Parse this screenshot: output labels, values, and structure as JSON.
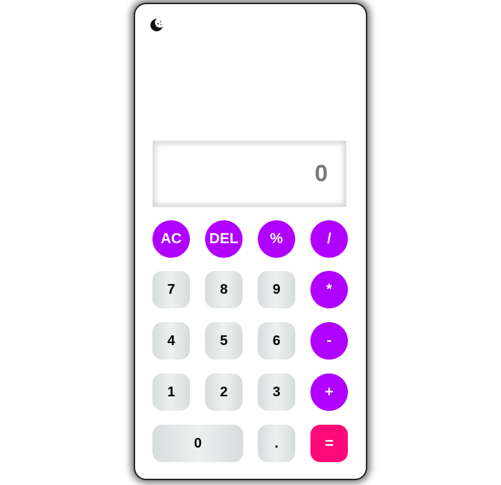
{
  "theme_toggle": {
    "icon": "moon-stars-icon"
  },
  "display": {
    "value": "0"
  },
  "keys": {
    "ac": "AC",
    "del": "DEL",
    "percent": "%",
    "divide": "/",
    "seven": "7",
    "eight": "8",
    "nine": "9",
    "multiply": "*",
    "four": "4",
    "five": "5",
    "six": "6",
    "subtract": "-",
    "one": "1",
    "two": "2",
    "three": "3",
    "add": "+",
    "zero": "0",
    "decimal": ".",
    "equals": "="
  },
  "colors": {
    "operator": "#b000ff",
    "equals": "#ff0a78",
    "display_text": "#7a7a7a"
  }
}
